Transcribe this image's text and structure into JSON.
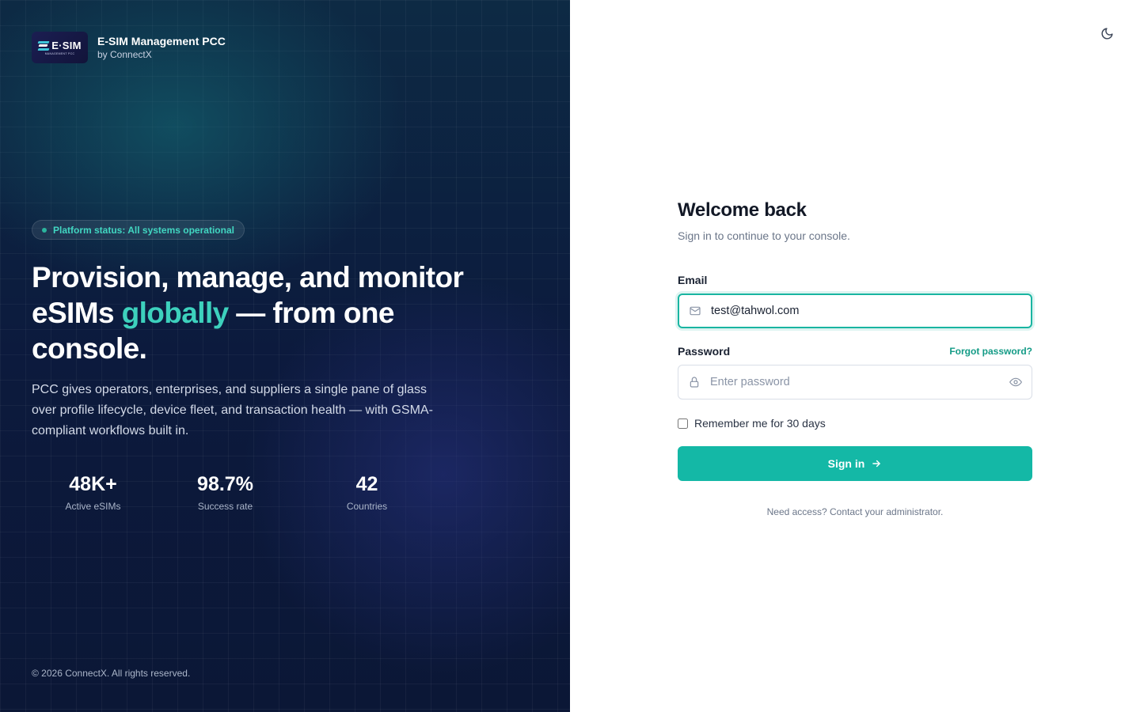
{
  "brand": {
    "logo_text": "E·SIM",
    "logo_subtext": "MANAGEMENT PCC",
    "title": "E-SIM Management PCC",
    "subtitle": "by ConnectX"
  },
  "hero": {
    "status": "Platform status: All systems operational",
    "headline_before": "Provision, manage, and monitor eSIMs ",
    "headline_accent": "globally",
    "headline_after": " — from one console.",
    "lead": "PCC gives operators, enterprises, and suppliers a single pane of glass over profile lifecycle, device fleet, and transaction health — with GSMA-compliant workflows built in.",
    "stats": [
      {
        "value": "48K+",
        "label": "Active eSIMs"
      },
      {
        "value": "98.7%",
        "label": "Success rate"
      },
      {
        "value": "42",
        "label": "Countries"
      }
    ],
    "copyright": "© 2026 ConnectX. All rights reserved."
  },
  "form": {
    "title": "Welcome back",
    "subtitle": "Sign in to continue to your console.",
    "email_label": "Email",
    "email_value": "test@tahwol.com",
    "password_label": "Password",
    "forgot": "Forgot password?",
    "password_placeholder": "Enter password",
    "remember": "Remember me for 30 days",
    "signin": "Sign in",
    "footer": "Need access? Contact your administrator."
  },
  "icons": {
    "theme": "moon-icon",
    "email": "mail-icon",
    "password": "lock-icon",
    "reveal": "eye-icon",
    "signin": "arrow-right-icon"
  },
  "colors": {
    "accent": "#14b8a6",
    "accent_text": "#3dd1bd",
    "panel_bg": "#0c1a3d"
  }
}
